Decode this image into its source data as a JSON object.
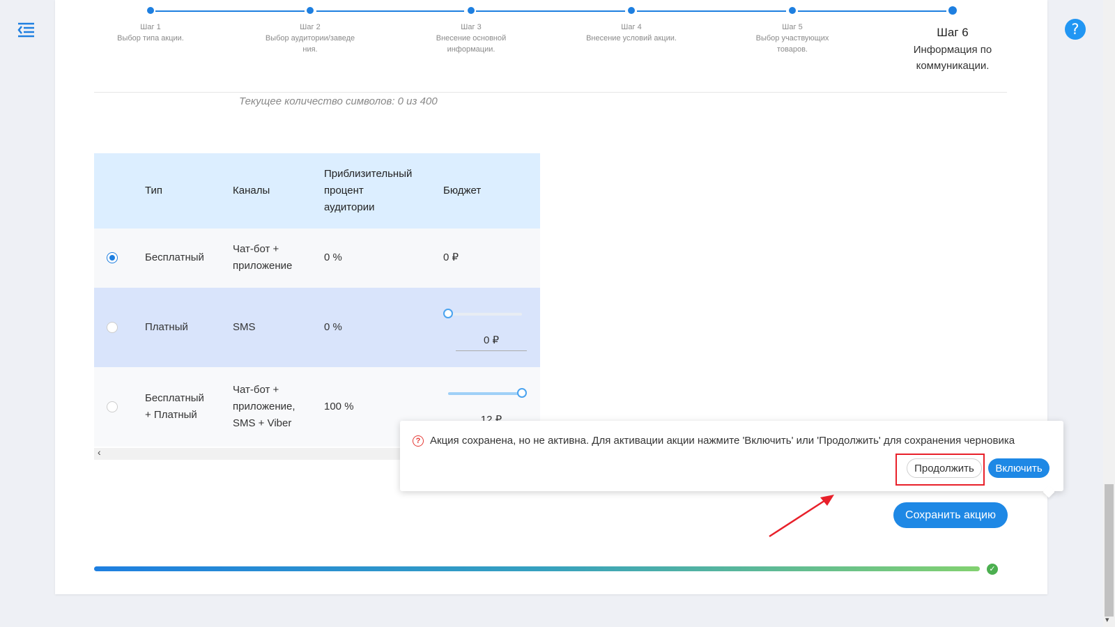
{
  "colors": {
    "accent": "#1e7fe0",
    "danger": "#e53935",
    "success": "#4caf50"
  },
  "icons": {
    "menu": "menu-collapse-icon",
    "help": "question-icon",
    "warning": "question-circle-icon",
    "success": "check-icon"
  },
  "header": {
    "help_label": "?"
  },
  "stepper": {
    "steps": [
      {
        "title": "Шаг 1",
        "desc": "Выбор типа акции."
      },
      {
        "title": "Шаг 2",
        "desc": "Выбор аудитории/заведения."
      },
      {
        "title": "Шаг 3",
        "desc": "Внесение основной информации."
      },
      {
        "title": "Шаг 4",
        "desc": "Внесение условий акции."
      },
      {
        "title": "Шаг 5",
        "desc": "Выбор участвующих товаров."
      },
      {
        "title": "Шаг 6",
        "desc": "Информация по коммуникации."
      }
    ],
    "active_step": 6
  },
  "form": {
    "char_count_text": "Текущее количество символов: 0 из 400"
  },
  "table": {
    "headers": {
      "type": "Тип",
      "channels": "Каналы",
      "audience_line1": "Приблизительный",
      "audience_line2": "процент",
      "audience_line3": "аудитории",
      "budget": "Бюджет"
    },
    "rows": [
      {
        "type_line1": "Бесплатный",
        "channels_line1": "Чат-бот +",
        "channels_line2": "приложение",
        "audience": "0 %",
        "budget": "0 ₽",
        "selected": true
      },
      {
        "type_line1": "Платный",
        "channels_line1": "SMS",
        "audience": "0 %",
        "budget": "0 ₽",
        "slider_fraction": 0,
        "selected": false
      },
      {
        "type_line1": "Бесплатный",
        "type_line2": "+ Платный",
        "channels_line1": "Чат-бот +",
        "channels_line2": "приложение,",
        "channels_line3": "SMS + Viber",
        "audience": "100 %",
        "budget": "12 ₽",
        "slider_fraction": 1,
        "selected": false
      }
    ],
    "scroll_left_label": "‹"
  },
  "popover": {
    "warning_icon_label": "?",
    "message": "Акция сохранена, но не активна. Для активации акции нажмите 'Включить' или 'Продолжить' для сохранения черновика",
    "continue_label": "Продолжить",
    "enable_label": "Включить"
  },
  "footer": {
    "save_label": "Сохранить акцию",
    "progress_fraction": 1,
    "check_label": "✓"
  },
  "scrollbar": {
    "down_label": "▾"
  }
}
